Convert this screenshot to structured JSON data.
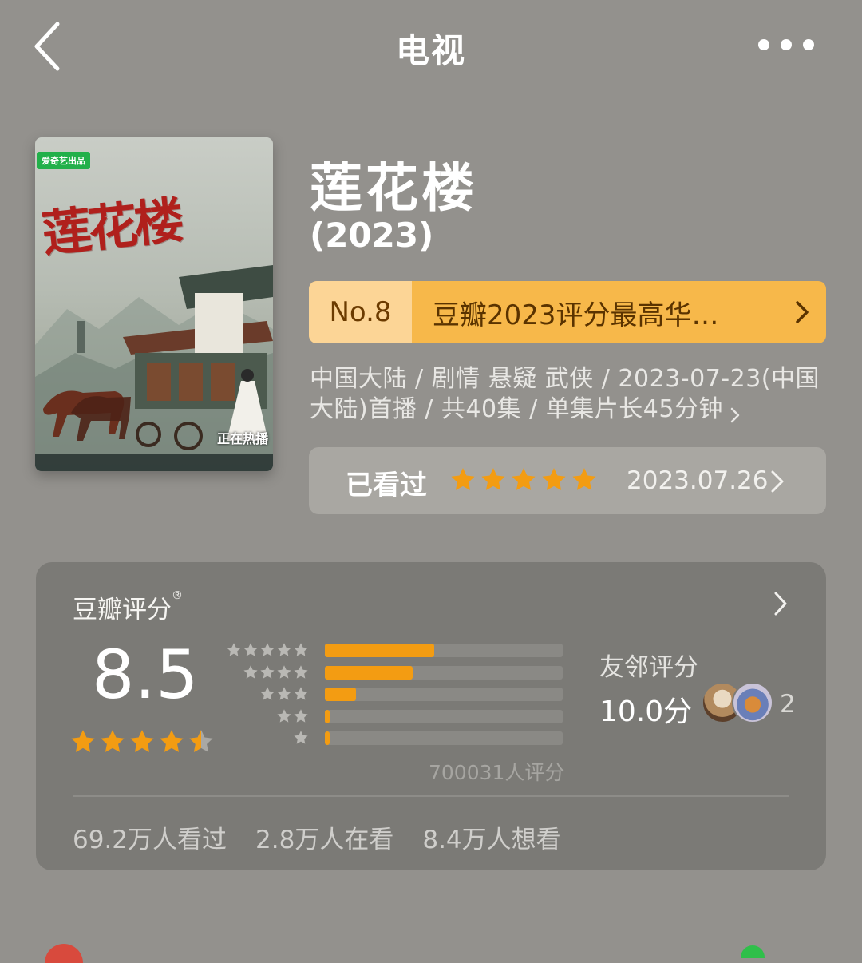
{
  "header": {
    "title": "电视"
  },
  "poster": {
    "badge": "爱奇艺出品",
    "title_art": "莲花楼",
    "hot_label": "正在热播"
  },
  "show": {
    "title": "莲花楼",
    "year": "(2023)"
  },
  "rank": {
    "number": "No.8",
    "text": "豆瓣2023评分最高华…"
  },
  "meta": {
    "line": "中国大陆 / 剧情 悬疑 武侠 / 2023-07-23(中国大陆)首播 / 共40集 / 单集片长45分钟"
  },
  "watched": {
    "label": "已看过",
    "stars": 5,
    "date": "2023.07.26"
  },
  "rating": {
    "title": "豆瓣评分",
    "registered_mark": "®",
    "score": "8.5",
    "star_value": 4.5,
    "distribution": [
      {
        "stars": 5,
        "fraction": 0.46
      },
      {
        "stars": 4,
        "fraction": 0.37
      },
      {
        "stars": 3,
        "fraction": 0.13
      },
      {
        "stars": 2,
        "fraction": 0.02
      },
      {
        "stars": 1,
        "fraction": 0.02
      }
    ],
    "votes": "700031人评分",
    "friend_label": "友邻评分",
    "friend_score": "10.0分",
    "friend_count": "2"
  },
  "stats": {
    "watched": "69.2万人看过",
    "watching": "2.8万人在看",
    "want": "8.4万人想看"
  },
  "colors": {
    "accent_orange": "#f39c12",
    "rank_bg": "#f7b84a",
    "page_bg": "#93918d"
  }
}
